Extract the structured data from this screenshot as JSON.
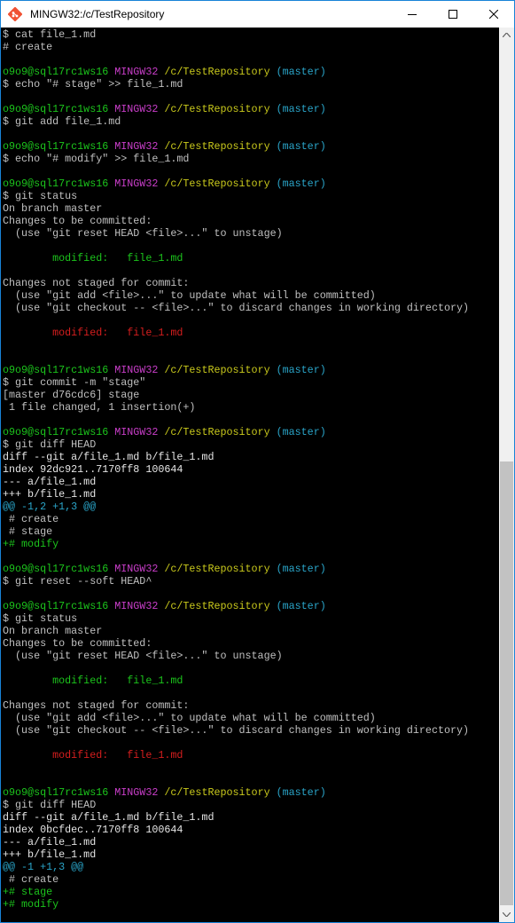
{
  "window": {
    "title": "MINGW32:/c/TestRepository",
    "app_icon": "git-bash-icon",
    "controls": {
      "minimize": "minimize-icon",
      "maximize": "maximize-icon",
      "close": "close-icon"
    }
  },
  "colors": {
    "background": "#000000",
    "text": "#c0c0c0",
    "user_host": "#1cc51c",
    "shell_label": "#c93ec9",
    "path": "#c9c91c",
    "branch": "#2aa5c9",
    "staged": "#1cc51c",
    "unstaged": "#d71e1e",
    "diff_hunk": "#2aa5c9",
    "diff_add": "#1cc51c"
  },
  "terminal": {
    "lines": [
      {
        "segments": [
          {
            "text": "$ cat file_1.md",
            "color": "default"
          }
        ]
      },
      {
        "segments": [
          {
            "text": "# create",
            "color": "default"
          }
        ]
      },
      {
        "segments": [
          {
            "text": "",
            "color": "default"
          }
        ]
      },
      {
        "segments": [
          {
            "text": "o9o9@sql17rc1ws16 ",
            "color": "green"
          },
          {
            "text": "MINGW32 ",
            "color": "magenta"
          },
          {
            "text": "/c/TestRepository ",
            "color": "yellow"
          },
          {
            "text": "(master)",
            "color": "cyan"
          }
        ]
      },
      {
        "segments": [
          {
            "text": "$ echo \"# stage\" >> file_1.md",
            "color": "default"
          }
        ]
      },
      {
        "segments": [
          {
            "text": "",
            "color": "default"
          }
        ]
      },
      {
        "segments": [
          {
            "text": "o9o9@sql17rc1ws16 ",
            "color": "green"
          },
          {
            "text": "MINGW32 ",
            "color": "magenta"
          },
          {
            "text": "/c/TestRepository ",
            "color": "yellow"
          },
          {
            "text": "(master)",
            "color": "cyan"
          }
        ]
      },
      {
        "segments": [
          {
            "text": "$ git add file_1.md",
            "color": "default"
          }
        ]
      },
      {
        "segments": [
          {
            "text": "",
            "color": "default"
          }
        ]
      },
      {
        "segments": [
          {
            "text": "o9o9@sql17rc1ws16 ",
            "color": "green"
          },
          {
            "text": "MINGW32 ",
            "color": "magenta"
          },
          {
            "text": "/c/TestRepository ",
            "color": "yellow"
          },
          {
            "text": "(master)",
            "color": "cyan"
          }
        ]
      },
      {
        "segments": [
          {
            "text": "$ echo \"# modify\" >> file_1.md",
            "color": "default"
          }
        ]
      },
      {
        "segments": [
          {
            "text": "",
            "color": "default"
          }
        ]
      },
      {
        "segments": [
          {
            "text": "o9o9@sql17rc1ws16 ",
            "color": "green"
          },
          {
            "text": "MINGW32 ",
            "color": "magenta"
          },
          {
            "text": "/c/TestRepository ",
            "color": "yellow"
          },
          {
            "text": "(master)",
            "color": "cyan"
          }
        ]
      },
      {
        "segments": [
          {
            "text": "$ git status",
            "color": "default"
          }
        ]
      },
      {
        "segments": [
          {
            "text": "On branch master",
            "color": "default"
          }
        ]
      },
      {
        "segments": [
          {
            "text": "Changes to be committed:",
            "color": "default"
          }
        ]
      },
      {
        "segments": [
          {
            "text": "  (use \"git reset HEAD <file>...\" to unstage)",
            "color": "default"
          }
        ]
      },
      {
        "segments": [
          {
            "text": "",
            "color": "default"
          }
        ]
      },
      {
        "segments": [
          {
            "text": "        modified:   file_1.md",
            "color": "green"
          }
        ]
      },
      {
        "segments": [
          {
            "text": "",
            "color": "default"
          }
        ]
      },
      {
        "segments": [
          {
            "text": "Changes not staged for commit:",
            "color": "default"
          }
        ]
      },
      {
        "segments": [
          {
            "text": "  (use \"git add <file>...\" to update what will be committed)",
            "color": "default"
          }
        ]
      },
      {
        "segments": [
          {
            "text": "  (use \"git checkout -- <file>...\" to discard changes in working directory)",
            "color": "default"
          }
        ]
      },
      {
        "segments": [
          {
            "text": "",
            "color": "default"
          }
        ]
      },
      {
        "segments": [
          {
            "text": "        modified:   file_1.md",
            "color": "red"
          }
        ]
      },
      {
        "segments": [
          {
            "text": "",
            "color": "default"
          }
        ]
      },
      {
        "segments": [
          {
            "text": "",
            "color": "default"
          }
        ]
      },
      {
        "segments": [
          {
            "text": "o9o9@sql17rc1ws16 ",
            "color": "green"
          },
          {
            "text": "MINGW32 ",
            "color": "magenta"
          },
          {
            "text": "/c/TestRepository ",
            "color": "yellow"
          },
          {
            "text": "(master)",
            "color": "cyan"
          }
        ]
      },
      {
        "segments": [
          {
            "text": "$ git commit -m \"stage\"",
            "color": "default"
          }
        ]
      },
      {
        "segments": [
          {
            "text": "[master d76cdc6] stage",
            "color": "default"
          }
        ]
      },
      {
        "segments": [
          {
            "text": " 1 file changed, 1 insertion(+)",
            "color": "default"
          }
        ]
      },
      {
        "segments": [
          {
            "text": "",
            "color": "default"
          }
        ]
      },
      {
        "segments": [
          {
            "text": "o9o9@sql17rc1ws16 ",
            "color": "green"
          },
          {
            "text": "MINGW32 ",
            "color": "magenta"
          },
          {
            "text": "/c/TestRepository ",
            "color": "yellow"
          },
          {
            "text": "(master)",
            "color": "cyan"
          }
        ]
      },
      {
        "segments": [
          {
            "text": "$ git diff HEAD",
            "color": "default"
          }
        ]
      },
      {
        "segments": [
          {
            "text": "diff --git a/file_1.md b/file_1.md",
            "color": "white"
          }
        ]
      },
      {
        "segments": [
          {
            "text": "index 92dc921..7170ff8 100644",
            "color": "white"
          }
        ]
      },
      {
        "segments": [
          {
            "text": "--- a/file_1.md",
            "color": "white"
          }
        ]
      },
      {
        "segments": [
          {
            "text": "+++ b/file_1.md",
            "color": "white"
          }
        ]
      },
      {
        "segments": [
          {
            "text": "@@ -1,2 +1,3 @@",
            "color": "cyan"
          }
        ]
      },
      {
        "segments": [
          {
            "text": " # create",
            "color": "default"
          }
        ]
      },
      {
        "segments": [
          {
            "text": " # stage",
            "color": "default"
          }
        ]
      },
      {
        "segments": [
          {
            "text": "+# modify",
            "color": "green"
          }
        ]
      },
      {
        "segments": [
          {
            "text": "",
            "color": "default"
          }
        ]
      },
      {
        "segments": [
          {
            "text": "o9o9@sql17rc1ws16 ",
            "color": "green"
          },
          {
            "text": "MINGW32 ",
            "color": "magenta"
          },
          {
            "text": "/c/TestRepository ",
            "color": "yellow"
          },
          {
            "text": "(master)",
            "color": "cyan"
          }
        ]
      },
      {
        "segments": [
          {
            "text": "$ git reset --soft HEAD^",
            "color": "default"
          }
        ]
      },
      {
        "segments": [
          {
            "text": "",
            "color": "default"
          }
        ]
      },
      {
        "segments": [
          {
            "text": "o9o9@sql17rc1ws16 ",
            "color": "green"
          },
          {
            "text": "MINGW32 ",
            "color": "magenta"
          },
          {
            "text": "/c/TestRepository ",
            "color": "yellow"
          },
          {
            "text": "(master)",
            "color": "cyan"
          }
        ]
      },
      {
        "segments": [
          {
            "text": "$ git status",
            "color": "default"
          }
        ]
      },
      {
        "segments": [
          {
            "text": "On branch master",
            "color": "default"
          }
        ]
      },
      {
        "segments": [
          {
            "text": "Changes to be committed:",
            "color": "default"
          }
        ]
      },
      {
        "segments": [
          {
            "text": "  (use \"git reset HEAD <file>...\" to unstage)",
            "color": "default"
          }
        ]
      },
      {
        "segments": [
          {
            "text": "",
            "color": "default"
          }
        ]
      },
      {
        "segments": [
          {
            "text": "        modified:   file_1.md",
            "color": "green"
          }
        ]
      },
      {
        "segments": [
          {
            "text": "",
            "color": "default"
          }
        ]
      },
      {
        "segments": [
          {
            "text": "Changes not staged for commit:",
            "color": "default"
          }
        ]
      },
      {
        "segments": [
          {
            "text": "  (use \"git add <file>...\" to update what will be committed)",
            "color": "default"
          }
        ]
      },
      {
        "segments": [
          {
            "text": "  (use \"git checkout -- <file>...\" to discard changes in working directory)",
            "color": "default"
          }
        ]
      },
      {
        "segments": [
          {
            "text": "",
            "color": "default"
          }
        ]
      },
      {
        "segments": [
          {
            "text": "        modified:   file_1.md",
            "color": "red"
          }
        ]
      },
      {
        "segments": [
          {
            "text": "",
            "color": "default"
          }
        ]
      },
      {
        "segments": [
          {
            "text": "",
            "color": "default"
          }
        ]
      },
      {
        "segments": [
          {
            "text": "o9o9@sql17rc1ws16 ",
            "color": "green"
          },
          {
            "text": "MINGW32 ",
            "color": "magenta"
          },
          {
            "text": "/c/TestRepository ",
            "color": "yellow"
          },
          {
            "text": "(master)",
            "color": "cyan"
          }
        ]
      },
      {
        "segments": [
          {
            "text": "$ git diff HEAD",
            "color": "default"
          }
        ]
      },
      {
        "segments": [
          {
            "text": "diff --git a/file_1.md b/file_1.md",
            "color": "white"
          }
        ]
      },
      {
        "segments": [
          {
            "text": "index 0bcfdec..7170ff8 100644",
            "color": "white"
          }
        ]
      },
      {
        "segments": [
          {
            "text": "--- a/file_1.md",
            "color": "white"
          }
        ]
      },
      {
        "segments": [
          {
            "text": "+++ b/file_1.md",
            "color": "white"
          }
        ]
      },
      {
        "segments": [
          {
            "text": "@@ -1 +1,3 @@",
            "color": "cyan"
          }
        ]
      },
      {
        "segments": [
          {
            "text": " # create",
            "color": "default"
          }
        ]
      },
      {
        "segments": [
          {
            "text": "+# stage",
            "color": "green"
          }
        ]
      },
      {
        "segments": [
          {
            "text": "+# modify",
            "color": "green"
          }
        ]
      }
    ]
  },
  "scrollbar": {
    "up_icon": "scroll-up-arrow-icon",
    "down_icon": "scroll-down-arrow-icon"
  }
}
